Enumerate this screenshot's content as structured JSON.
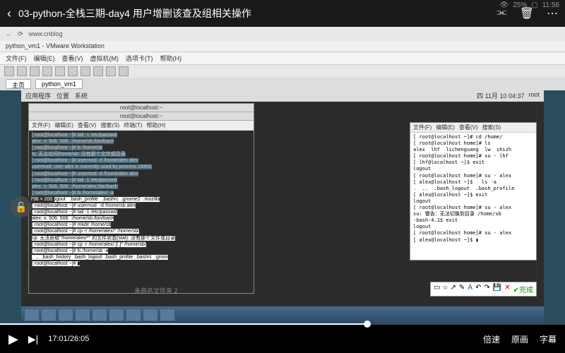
{
  "status": {
    "eye": "👁",
    "pct": "25%",
    "batt": "▢",
    "time": "11:56"
  },
  "topbar": {
    "title": "03-python-全栈三期-day4 用户增删该查及组相关操作"
  },
  "browser": {
    "url": "www.cnblog"
  },
  "vm": {
    "title": "python_vm1 - VMware Workstation",
    "menu": [
      "文件(F)",
      "编辑(E)",
      "查看(V)",
      "虚拟机(M)",
      "选项卡(T)",
      "帮助(H)"
    ],
    "tabs": {
      "home": "主页",
      "vm1": "python_vm1"
    }
  },
  "linux": {
    "apps": "应用程序",
    "places": "位置",
    "system": "系统",
    "date": "四 11月 10 04:37",
    "user": "root"
  },
  "term1": {
    "title": "root@localhost:~",
    "subtitle": "root@localhost:~",
    "menu": [
      "文件(F)",
      "编辑(E)",
      "查看(V)",
      "搜索(S)",
      "终端(T)",
      "帮助(H)"
    ],
    "lines": "[ root@localhost ~]# tail -1 /etc/passwd\nalex: x: 506: 506: :/home/sb:/bin/bash\n[ root@localhost ~]# ls /home/sb\nls: 无法访问/home/sb: 没有那个文件或目录\n[ root@localhost ~]# usermod -d /home/alex alex\nusermod: user alex is currently used by process 28455\n[ root@localhost ~]# usermod -d /home/alex alex\n[ root@localhost ~]# tail -1 /etc/passwd\nalex: x: 506: 506: :/home/alex:/bin/bash\n[ root@localhost ~]# ls /home/alex/ -a",
    "lines2": ".   .bash_logout   .bash_profile   .bashrc  .gnome2  .mozilla\n[ root@localhost ~]# usermod  -d /home/sb alex\n[ root@localhost ~]# tail -1 /etc/passwd\nalex: x: 506: 506: :/home/sb:/bin/bash\n[ root@localhost ~]# mkdir /home/sb\n[ root@localhost ~]# cp -r /home/alex/* /home/sb/\ncp: 无法获取\"/home/alex/*\" 的文件状态(stat): 没有那个文件或目录\n[ root@localhost ~]# cp -r /home/alex/.[!.]* /home/sb/\n[ root@localhost ~]# ls /home/sb -a\n.  ..  .bash_history  .bash_logout  .bash_profile  .bashrc  .gnom\n[ root@localhost ~]# ▮"
  },
  "term2": {
    "menu": [
      "文件(F)",
      "编辑(E)",
      "查看(V)",
      "搜索(S)"
    ],
    "lines": "[ root@localhost ~]# cd /home/\n[ root@localhost home]# ls\nalex  lhf  lichenguang  lw  shizh\n[ root@localhost home]# su - lhf\n[ lhf@localhost ~]$ exit\nlogout\n[ root@localhost home]# su - alex\n[ alex@localhost ~]$   ls -a\n.  ..  .bash_logout  .bash_profile\n[ alex@localhost ~]$ exit\nlogout\n[ root@localhost home]# su - alex\nsu: 警告：无法切换到目录 /home/sb\n-bash-4.1$ exit\nlogout\n[ root@localhost home]# su - alex\n[ alex@localhost ~]$ ▮"
  },
  "dim": "798 × 200",
  "folder": "未命名文件夹 2",
  "annot": {
    "done": "完成"
  },
  "controls": {
    "time": "17:01/26:05",
    "speed": "倍速",
    "quality": "原画",
    "subtitle": "字幕"
  }
}
